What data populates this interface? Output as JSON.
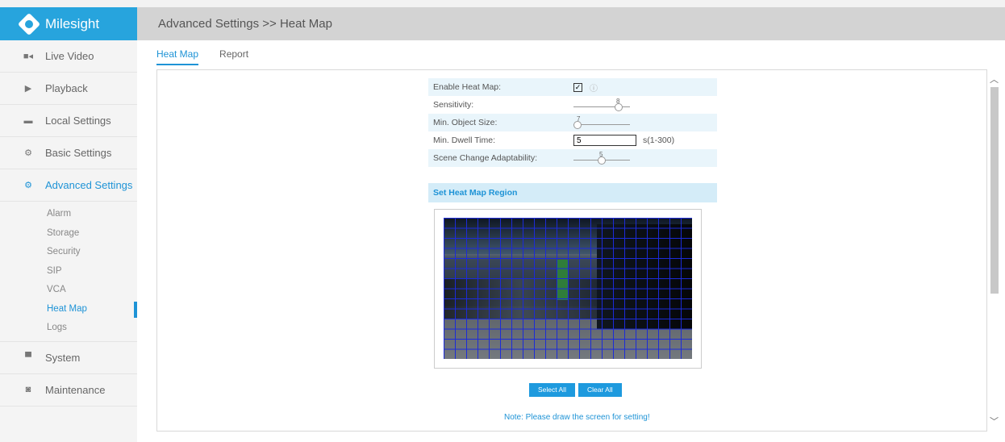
{
  "brand": {
    "name": "Milesight"
  },
  "header": {
    "title": "Advanced Settings >> Heat Map"
  },
  "sidebar": {
    "items": [
      {
        "label": "Live Video",
        "icon": "video-camera-icon"
      },
      {
        "label": "Playback",
        "icon": "play-icon"
      },
      {
        "label": "Local Settings",
        "icon": "folder-icon"
      },
      {
        "label": "Basic Settings",
        "icon": "gear-icon"
      },
      {
        "label": "Advanced Settings",
        "icon": "gears-icon",
        "active": true
      }
    ],
    "subitems": [
      "Alarm",
      "Storage",
      "Security",
      "SIP",
      "VCA",
      "Heat Map",
      "Logs"
    ],
    "active_subitem": "Heat Map",
    "bottom_items": [
      {
        "label": "System",
        "icon": "monitor-icon"
      },
      {
        "label": "Maintenance",
        "icon": "camera-icon"
      }
    ]
  },
  "tabs": [
    "Heat Map",
    "Report"
  ],
  "active_tab": "Heat Map",
  "form": {
    "enable_label": "Enable Heat Map:",
    "enable_checked": true,
    "enable_mark": "✓",
    "sensitivity_label": "Sensitivity:",
    "sensitivity_value": "8",
    "sensitivity_max": 10,
    "min_object_size_label": "Min. Object Size:",
    "min_object_size_value": "7",
    "dwell_label": "Min. Dwell Time:",
    "dwell_value": "5",
    "dwell_unit": "s(1-300)",
    "scene_label": "Scene Change Adaptability:",
    "scene_value": "5"
  },
  "region": {
    "title": "Set Heat Map Region"
  },
  "buttons": {
    "select_all": "Select All",
    "clear_all": "Clear All"
  },
  "note": "Note: Please draw the screen for setting!",
  "colors": {
    "accent": "#1e93d6",
    "brand": "#27a4dd",
    "grid": "#1c2bd8"
  }
}
